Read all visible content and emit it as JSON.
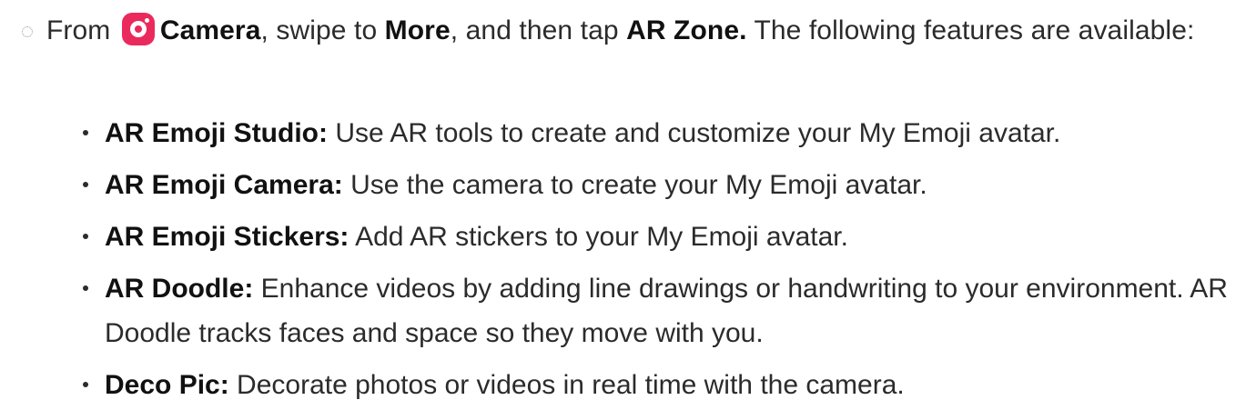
{
  "step": {
    "pre": "From ",
    "camera_icon": "camera-app-icon",
    "camera": "Camera",
    "mid1": ", swipe to ",
    "more": "More",
    "mid2": ", and then tap ",
    "ar_zone": "AR Zone.",
    "post": " The following features are available:"
  },
  "features": [
    {
      "term": "AR Emoji Studio:",
      "desc": " Use AR tools to create and customize your My Emoji avatar."
    },
    {
      "term": "AR Emoji Camera:",
      "desc": " Use the camera to create your My Emoji avatar."
    },
    {
      "term": "AR Emoji Stickers:",
      "desc": " Add AR stickers to your My Emoji avatar."
    },
    {
      "term": "AR Doodle:",
      "desc": " Enhance videos by adding line drawings or handwriting to your environment. AR Doodle tracks faces and space so they move with you."
    },
    {
      "term": "Deco Pic:",
      "desc": " Decorate photos or videos in real time with the camera."
    }
  ],
  "colors": {
    "camera_icon": "#ea2a5c",
    "text": "#2b2b2b"
  }
}
